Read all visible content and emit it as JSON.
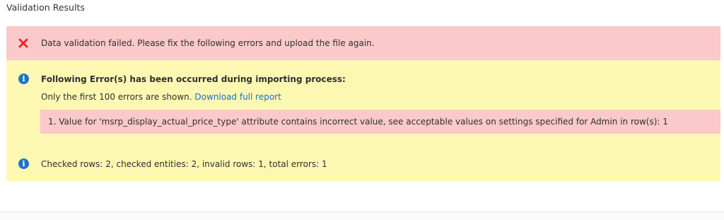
{
  "section": {
    "title": "Validation Results"
  },
  "error_message": {
    "icon": "error-x-icon",
    "icon_color": "#e22626",
    "text": "Data validation failed. Please fix the following errors and upload the file again."
  },
  "warning_message": {
    "icon": "info-icon",
    "icon_color": "#1f74c9",
    "heading": "Following Error(s) has been occurred during importing process:",
    "subtext": "Only the first 100 errors are shown.",
    "link_label": "Download full report",
    "errors": [
      "1. Value for 'msrp_display_actual_price_type' attribute contains incorrect value, see acceptable values on settings specified for Admin in row(s): 1"
    ]
  },
  "notice_message": {
    "icon": "info-icon",
    "text": "Checked rows: 2, checked entities: 2, invalid rows: 1, total errors: 1"
  },
  "colors": {
    "error_bg": "#fbc9c9",
    "warning_bg": "#fcf8b2",
    "link": "#1a6fc8"
  }
}
